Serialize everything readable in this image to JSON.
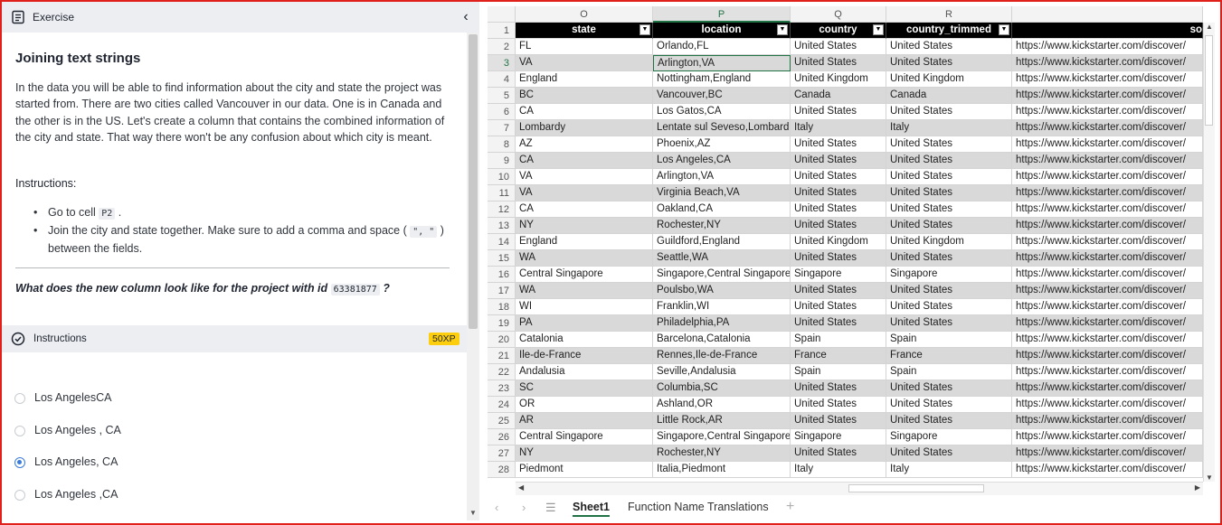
{
  "exercise": {
    "header_label": "Exercise",
    "title": "Joining text strings",
    "paragraph": "In the data you will be able to find information about the city and state the project was started from. There are two cities called Vancouver in our data. One is in Canada and the other is in the US. Let's create a column that contains the combined information of the city and state. That way there won't be any confusion about which city is meant.",
    "instructions_label": "Instructions:",
    "bullet1_pre": "Go to cell ",
    "bullet1_code": "P2",
    "bullet1_post": " .",
    "bullet2_pre": "Join the city and state together. Make sure to add a comma and space ( ",
    "bullet2_code": "\", \"",
    "bullet2_post": " ) between the fields.",
    "question_pre": "What does the new column look like for the project with id ",
    "question_code": "63381877",
    "question_post": " ?",
    "instr_bar_label": "Instructions",
    "xp": "50XP",
    "options": [
      "Los AngelesCA",
      "Los Angeles , CA",
      "Los Angeles, CA",
      "Los Angeles ,CA"
    ],
    "selected_option": 2
  },
  "sheet": {
    "columns": [
      "O",
      "P",
      "Q",
      "R"
    ],
    "headers": [
      "state",
      "location",
      "country",
      "country_trimmed",
      "so"
    ],
    "rows": [
      [
        "FL",
        "Orlando,FL",
        "United States",
        "United States",
        "https://www.kickstarter.com/discover/"
      ],
      [
        "VA",
        "Arlington,VA",
        "United States",
        "United States",
        "https://www.kickstarter.com/discover/"
      ],
      [
        "England",
        "Nottingham,England",
        "United Kingdom",
        "United Kingdom",
        "https://www.kickstarter.com/discover/"
      ],
      [
        "BC",
        "Vancouver,BC",
        "Canada",
        "Canada",
        "https://www.kickstarter.com/discover/"
      ],
      [
        "CA",
        "Los Gatos,CA",
        "United States",
        "United States",
        "https://www.kickstarter.com/discover/"
      ],
      [
        "Lombardy",
        "Lentate sul Seveso,Lombard",
        "Italy",
        "Italy",
        "https://www.kickstarter.com/discover/"
      ],
      [
        "AZ",
        "Phoenix,AZ",
        "United States",
        "United States",
        "https://www.kickstarter.com/discover/"
      ],
      [
        "CA",
        "Los Angeles,CA",
        "United States",
        "United States",
        "https://www.kickstarter.com/discover/"
      ],
      [
        "VA",
        "Arlington,VA",
        "United States",
        "United States",
        "https://www.kickstarter.com/discover/"
      ],
      [
        "VA",
        "Virginia Beach,VA",
        "United States",
        "United States",
        "https://www.kickstarter.com/discover/"
      ],
      [
        "CA",
        "Oakland,CA",
        "United States",
        "United States",
        "https://www.kickstarter.com/discover/"
      ],
      [
        "NY",
        "Rochester,NY",
        "United States",
        "United States",
        "https://www.kickstarter.com/discover/"
      ],
      [
        "England",
        "Guildford,England",
        "United Kingdom",
        "United Kingdom",
        "https://www.kickstarter.com/discover/"
      ],
      [
        "WA",
        "Seattle,WA",
        "United States",
        "United States",
        "https://www.kickstarter.com/discover/"
      ],
      [
        "Central Singapore",
        "Singapore,Central Singapore",
        "Singapore",
        "Singapore",
        "https://www.kickstarter.com/discover/"
      ],
      [
        "WA",
        "Poulsbo,WA",
        "United States",
        "United States",
        "https://www.kickstarter.com/discover/"
      ],
      [
        "WI",
        "Franklin,WI",
        "United States",
        "United States",
        "https://www.kickstarter.com/discover/"
      ],
      [
        "PA",
        "Philadelphia,PA",
        "United States",
        "United States",
        "https://www.kickstarter.com/discover/"
      ],
      [
        "Catalonia",
        "Barcelona,Catalonia",
        "Spain",
        "Spain",
        "https://www.kickstarter.com/discover/"
      ],
      [
        "Ile-de-France",
        "Rennes,Ile-de-France",
        "France",
        "France",
        "https://www.kickstarter.com/discover/"
      ],
      [
        "Andalusia",
        "Seville,Andalusia",
        "Spain",
        "Spain",
        "https://www.kickstarter.com/discover/"
      ],
      [
        "SC",
        "Columbia,SC",
        "United States",
        "United States",
        "https://www.kickstarter.com/discover/"
      ],
      [
        "OR",
        "Ashland,OR",
        "United States",
        "United States",
        "https://www.kickstarter.com/discover/"
      ],
      [
        "AR",
        "Little Rock,AR",
        "United States",
        "United States",
        "https://www.kickstarter.com/discover/"
      ],
      [
        "Central Singapore",
        "Singapore,Central Singapore",
        "Singapore",
        "Singapore",
        "https://www.kickstarter.com/discover/"
      ],
      [
        "NY",
        "Rochester,NY",
        "United States",
        "United States",
        "https://www.kickstarter.com/discover/"
      ],
      [
        "Piedmont",
        "Italia,Piedmont",
        "Italy",
        "Italy",
        "https://www.kickstarter.com/discover/"
      ]
    ],
    "selected_cell": "P3",
    "tabs": [
      "Sheet1",
      "Function Name Translations"
    ],
    "add_tab": "+"
  },
  "colors": {
    "accent": "#217346",
    "xp_badge": "#fcce0d",
    "frame": "#e0211b"
  }
}
